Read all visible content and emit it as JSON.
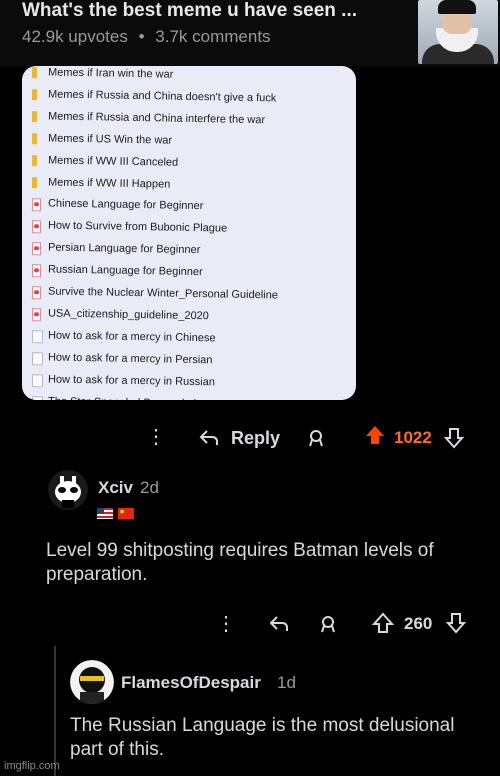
{
  "post": {
    "title": "What's the best meme u have seen ...",
    "upvotes": "42.9k upvotes",
    "separator": "•",
    "comments": "3.7k comments"
  },
  "files": [
    {
      "icon": "folder",
      "name": "Memes if Iran win the war"
    },
    {
      "icon": "folder",
      "name": "Memes if Russia and China doesn't give a fuck"
    },
    {
      "icon": "folder",
      "name": "Memes if Russia and China interfere the war"
    },
    {
      "icon": "folder",
      "name": "Memes if US Win the war"
    },
    {
      "icon": "folder",
      "name": "Memes if WW III Canceled"
    },
    {
      "icon": "folder",
      "name": "Memes if WW III Happen"
    },
    {
      "icon": "pdf",
      "name": "Chinese Language for Beginner"
    },
    {
      "icon": "pdf",
      "name": "How to Survive from Bubonic Plague"
    },
    {
      "icon": "pdf",
      "name": "Persian Language for Beginner"
    },
    {
      "icon": "pdf",
      "name": "Russian Language for Beginner"
    },
    {
      "icon": "pdf",
      "name": "Survive the Nuclear Winter_Personal Guideline"
    },
    {
      "icon": "pdf",
      "name": "USA_citizenship_guideline_2020"
    },
    {
      "icon": "doc",
      "name": "How to ask for a mercy in Chinese"
    },
    {
      "icon": "doc",
      "name": "How to ask for a mercy in Persian"
    },
    {
      "icon": "doc",
      "name": "How to ask for a mercy in Russian"
    },
    {
      "icon": "doc",
      "name": "The Star-Spangled Banner lyrics"
    }
  ],
  "actions1": {
    "reply": "Reply",
    "votes": "1022"
  },
  "comment1": {
    "user": "Xciv",
    "age": "2d",
    "text": "Level 99 shitposting requires Batman levels of preparation.",
    "votes": "260"
  },
  "comment2": {
    "user": "FlamesOfDespair",
    "age": "1d",
    "text": "The Russian Language is the most delusional part of this."
  },
  "watermark": "imgflip.com",
  "colors": {
    "upvote": "#ff4500",
    "background": "#000000",
    "panel": "#e9ebf6"
  }
}
